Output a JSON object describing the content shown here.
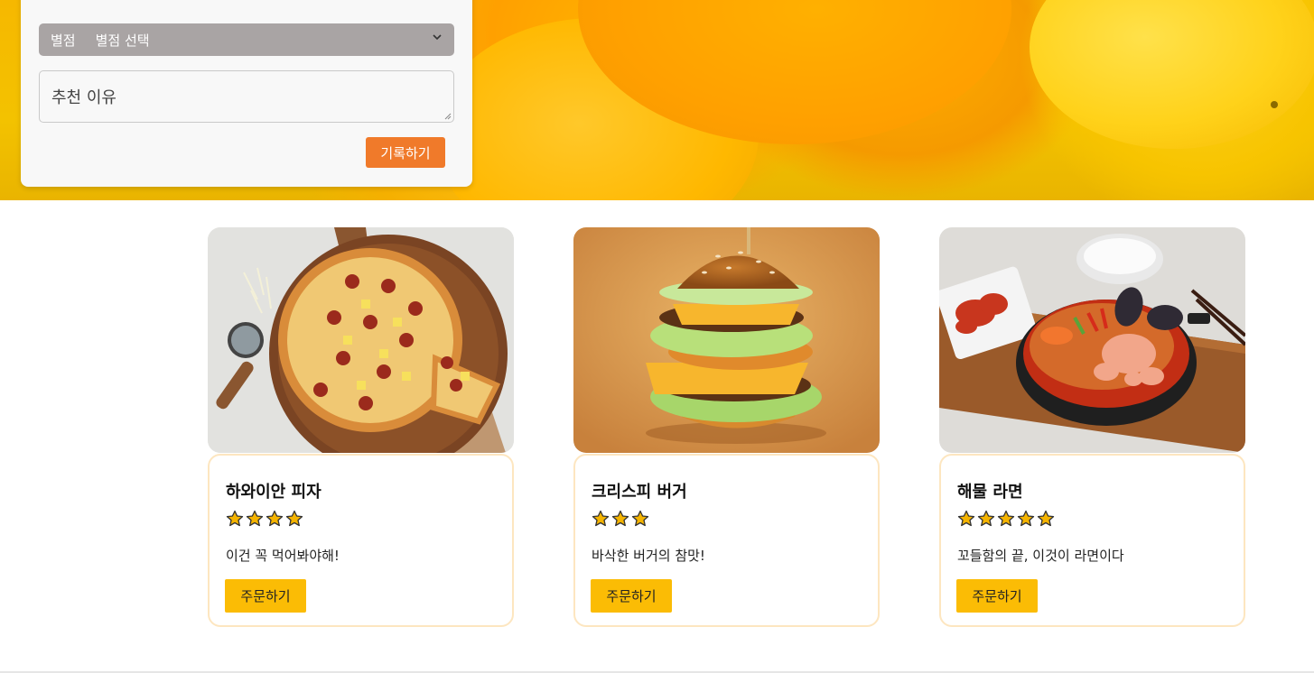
{
  "form": {
    "rating_label": "별점",
    "rating_value": "별점 선택",
    "reason_placeholder": "추천 이유",
    "submit_label": "기록하기"
  },
  "menu": [
    {
      "name": "하와이안 피자",
      "stars": 4,
      "desc": "이건 꼭 먹어봐야해!",
      "order_label": "주문하기",
      "image": "pizza"
    },
    {
      "name": "크리스피 버거",
      "stars": 3,
      "desc": "바삭한 버거의 참맛!",
      "order_label": "주문하기",
      "image": "burger"
    },
    {
      "name": "해물 라면",
      "stars": 5,
      "desc": "꼬들함의 끝, 이것이 라면이다",
      "order_label": "주문하기",
      "image": "ramen"
    }
  ],
  "colors": {
    "accent_orange": "#f07a2a",
    "order_yellow": "#fbbc05",
    "card_border": "#fde6c0",
    "select_bg": "#a9a4a4",
    "star_fill": "#f5b400"
  },
  "icons": {
    "select_arrow": "chevron-down-icon",
    "rating": "star-icon"
  }
}
